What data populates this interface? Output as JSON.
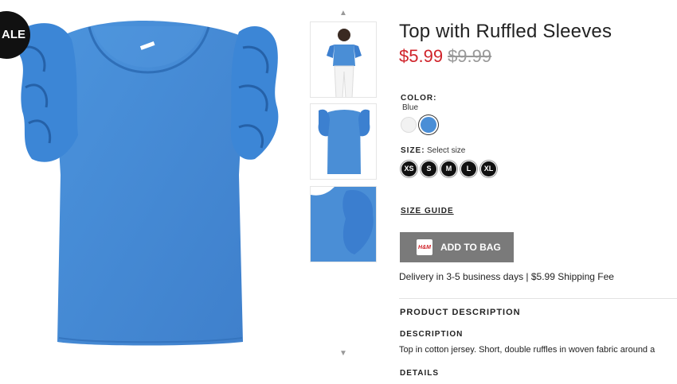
{
  "badge": {
    "sale": "ALE"
  },
  "product": {
    "title": "Top with Ruffled Sleeves",
    "price_sale": "$5.99",
    "price_original": "$9.99"
  },
  "color": {
    "label": "COLOR:",
    "selected": "Blue",
    "swatches": [
      {
        "name": "white",
        "hex": "#f2f2f2"
      },
      {
        "name": "blue",
        "hex": "#4a8ed6"
      }
    ]
  },
  "size": {
    "label": "SIZE:",
    "hint": "Select size",
    "options": [
      "XS",
      "S",
      "M",
      "L",
      "XL"
    ]
  },
  "size_guide": "SIZE GUIDE",
  "cart": {
    "button_label": "ADD TO BAG",
    "icon_text": "H&M"
  },
  "delivery": "Delivery in 3-5 business days | $5.99 Shipping Fee",
  "sections": {
    "product_description": "PRODUCT DESCRIPTION",
    "description_heading": "DESCRIPTION",
    "description_text": "Top in cotton jersey. Short, double ruffles in woven fabric around a",
    "details_heading": "DETAILS"
  },
  "icons": {
    "up": "chevron-up-icon",
    "down": "chevron-down-icon",
    "bag": "shopping-bag-icon"
  },
  "colors": {
    "sale_price": "#d0242b",
    "product_blue": "#4a8ed6",
    "button": "#7a7a7a"
  }
}
